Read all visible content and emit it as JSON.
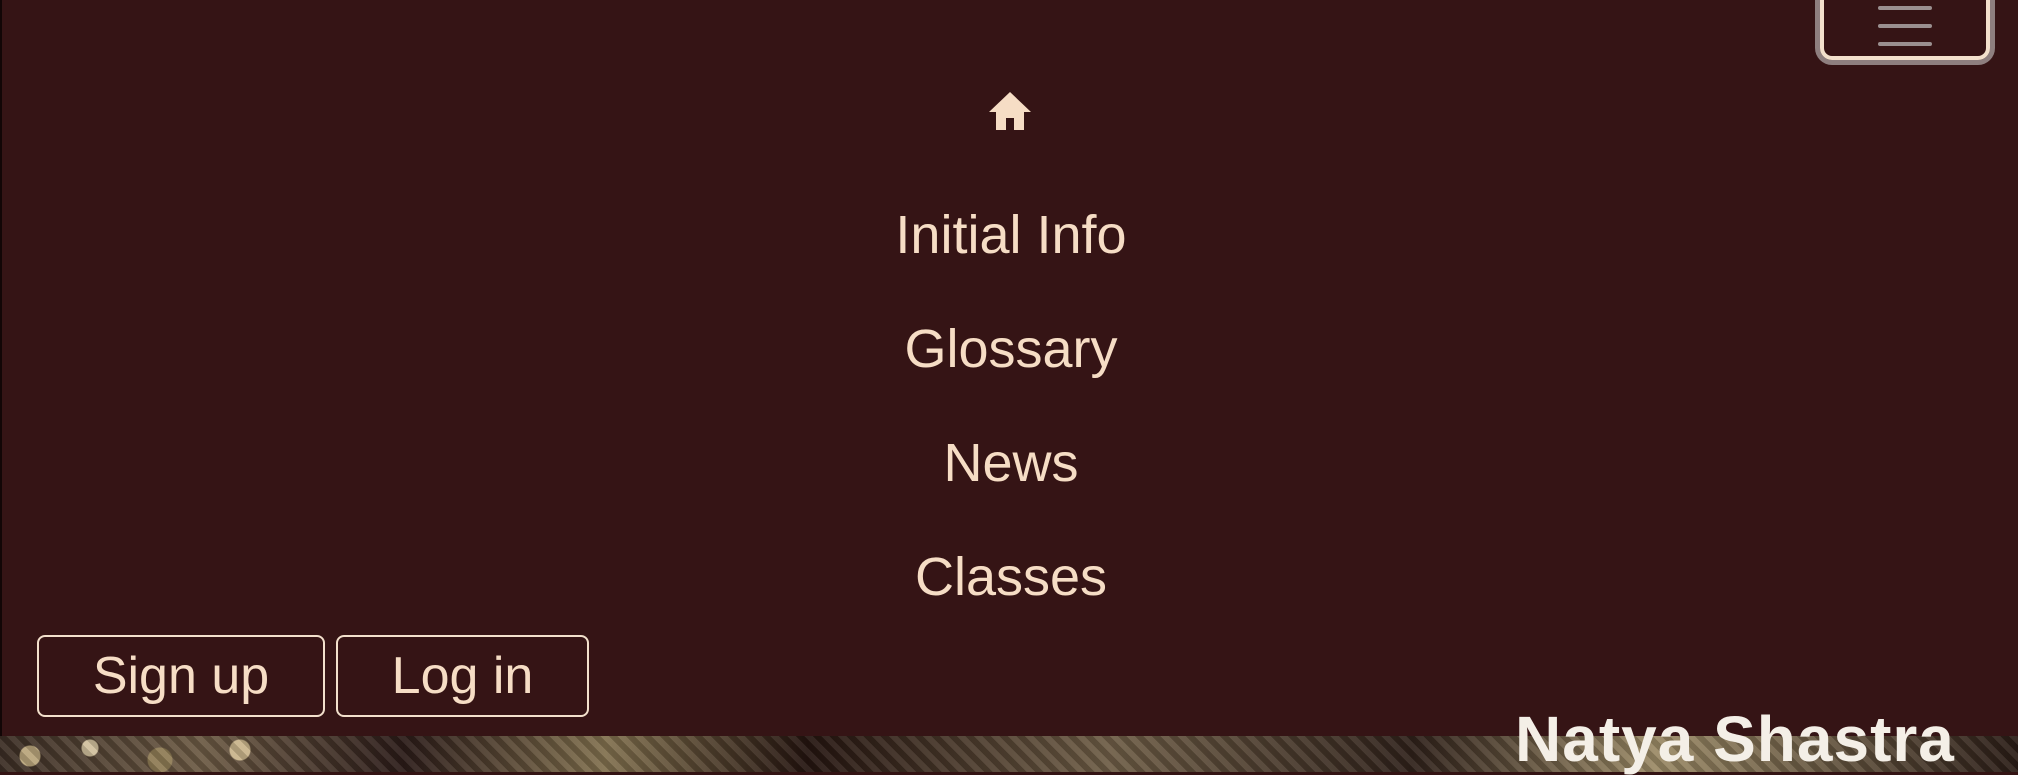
{
  "nav": {
    "home_icon": "home-icon",
    "items": [
      {
        "label": "Initial Info"
      },
      {
        "label": "Glossary"
      },
      {
        "label": "News"
      },
      {
        "label": "Classes"
      }
    ]
  },
  "auth": {
    "signup_label": "Sign up",
    "login_label": "Log in"
  },
  "toggler": {
    "icon": "hamburger-icon"
  },
  "hero": {
    "title": "Natya Shastra"
  },
  "colors": {
    "menu_bg": "#351415",
    "text": "#f6ddc5",
    "border": "#f3e0cc"
  }
}
